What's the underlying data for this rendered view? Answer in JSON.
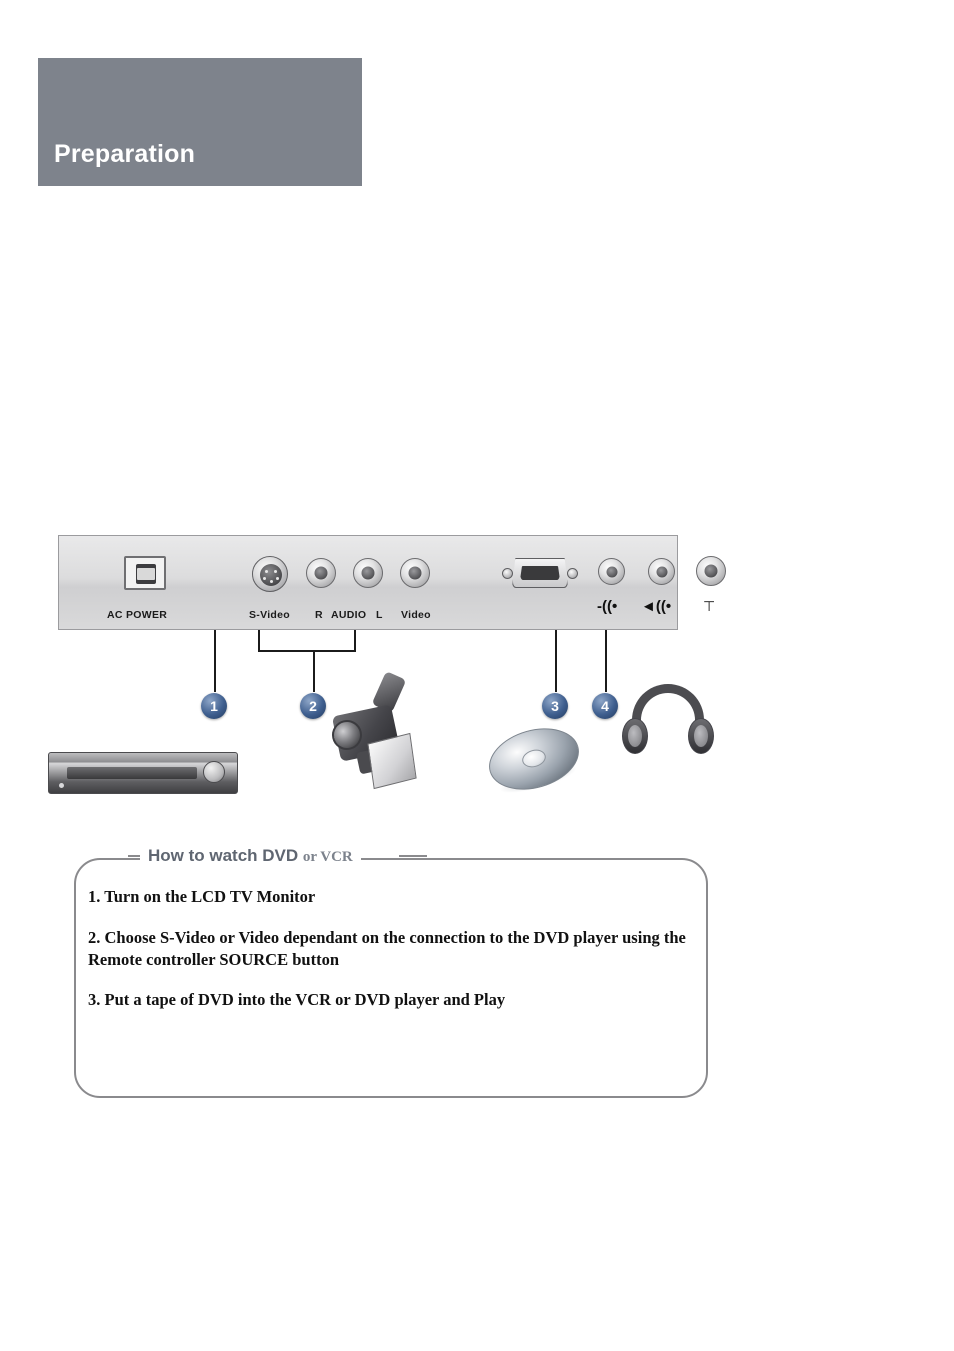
{
  "header": {
    "title": "Preparation"
  },
  "panel": {
    "name": "rear-connector-panel",
    "labels": [
      {
        "id": "ac-power",
        "text": "AC  POWER"
      },
      {
        "id": "s-video",
        "text": "S-Video"
      },
      {
        "id": "audio-r",
        "text": "R"
      },
      {
        "id": "audio",
        "text": "AUDIO"
      },
      {
        "id": "audio-l",
        "text": "L"
      },
      {
        "id": "video",
        "text": "Video"
      },
      {
        "id": "audio-out",
        "text": ""
      },
      {
        "id": "headphone",
        "text": ""
      }
    ],
    "icons": {
      "audio_in": "speaker-in-icon",
      "audio_out": "speaker-out-icon",
      "headphone": "headphone-jack-icon"
    }
  },
  "callouts": [
    {
      "number": "1",
      "target": "s-video-jack",
      "device": "vcr-illustration"
    },
    {
      "number": "2",
      "target": "audio-video-jacks",
      "device": "camcorder-illustration"
    },
    {
      "number": "3",
      "target": "audio-in-jack",
      "device": "dvd-disc-illustration"
    },
    {
      "number": "4",
      "target": "audio-out-jack",
      "device": "headphones-illustration"
    }
  ],
  "howto": {
    "title_main": "How to watch DVD",
    "title_sub": "or VCR",
    "steps": [
      "1. Turn on the LCD TV Monitor",
      "2. Choose S-Video or Video dependant on the connection to the DVD player using the Remote controller SOURCE button",
      "3. Put a tape of DVD into the VCR or DVD player and Play"
    ]
  },
  "colors": {
    "header_band": "#7e838c",
    "header_text": "#ffffff",
    "bullet": "#3f5f8f",
    "box_border": "#8a8a8d",
    "title_text": "#5f6671"
  }
}
